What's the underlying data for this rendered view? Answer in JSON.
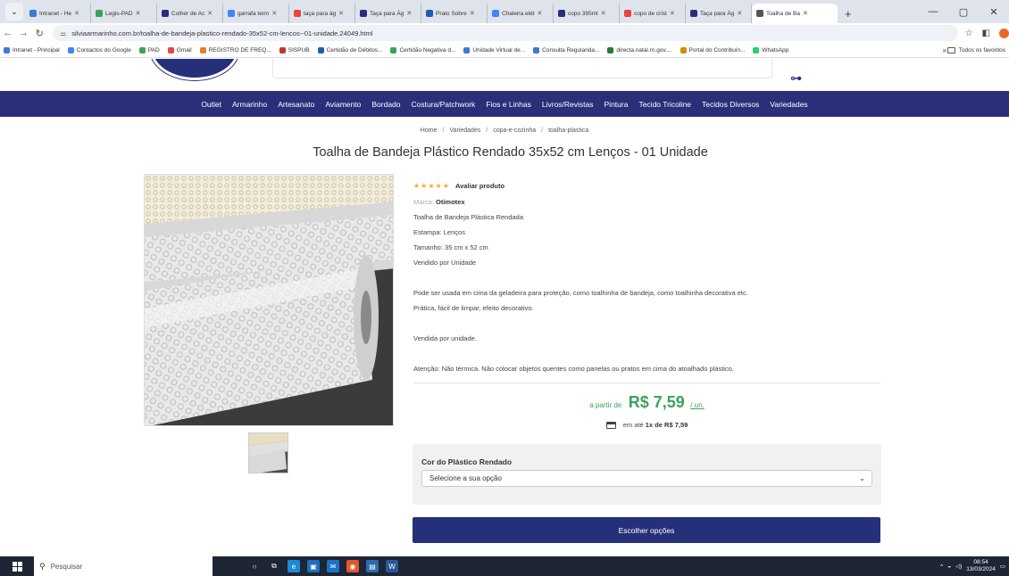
{
  "browser": {
    "tabs": [
      {
        "title": "Intranet - He",
        "color": "#3a7bd5",
        "active": false
      },
      {
        "title": "Legis-PAD",
        "color": "#3ba35a",
        "active": false
      },
      {
        "title": "Colher de Ac",
        "color": "#26307a",
        "active": false
      },
      {
        "title": "garrafa term",
        "color": "#4285f4",
        "active": false
      },
      {
        "title": "taça para ág",
        "color": "#e8453c",
        "active": false
      },
      {
        "title": "Taça para Ág",
        "color": "#26307a",
        "active": false
      },
      {
        "title": "Prato Sobre",
        "color": "#1f5fa8",
        "active": false
      },
      {
        "title": "Chaleira elét",
        "color": "#4285f4",
        "active": false
      },
      {
        "title": "copo 395ml",
        "color": "#26307a",
        "active": false
      },
      {
        "title": "copo de crist",
        "color": "#e8453c",
        "active": false
      },
      {
        "title": "Taça para Ág",
        "color": "#26307a",
        "active": false
      },
      {
        "title": "Toalha de Ba",
        "color": "#555555",
        "active": true
      }
    ],
    "new_tab": "+",
    "window_controls": {
      "minimize": "—",
      "maximize": "▢",
      "close": "✕"
    },
    "url": "silviaarmarinho.com.br/toalha-de-bandeja-plastico-rendado-35x52-cm-lencos--01-unidade.24049.html",
    "bookmarks": [
      {
        "label": "Intranet - Principal",
        "color": "#3a7bd5"
      },
      {
        "label": "Contactos do Google",
        "color": "#4285f4"
      },
      {
        "label": "PAD",
        "color": "#3ba35a"
      },
      {
        "label": "Gmail",
        "color": "#e8453c"
      },
      {
        "label": "REGISTRO DE FREQ...",
        "color": "#e67e22"
      },
      {
        "label": "SISPUB",
        "color": "#c0392b"
      },
      {
        "label": "Certidão de Débitos...",
        "color": "#1f5fa8"
      },
      {
        "label": "Certidão Negativa d...",
        "color": "#3ba35a"
      },
      {
        "label": "Unidade Virtual de...",
        "color": "#3a7bd5"
      },
      {
        "label": "Consulta Regularida...",
        "color": "#3a7bd5"
      },
      {
        "label": "directa.natal.rn.gov....",
        "color": "#2d7a2d"
      },
      {
        "label": "Portal do Contribuin...",
        "color": "#d68910"
      },
      {
        "label": "WhatsApp",
        "color": "#25d366"
      }
    ],
    "bookmarks_more": "»",
    "all_favorites": "Todos os favoritos"
  },
  "site": {
    "nav": [
      "Outlet",
      "Armarinho",
      "Artesanato",
      "Aviamento",
      "Bordado",
      "Costura/Patchwork",
      "Fios e Linhas",
      "Livros/Revistas",
      "Pintura",
      "Tecido Tricoline",
      "Tecidos Diversos",
      "Variedades"
    ]
  },
  "breadcrumb": [
    "Home",
    "Variedades",
    "copa-e-cozinha",
    "toalha-plastica"
  ],
  "product": {
    "title": "Toalha de Bandeja Plástico Rendado 35x52 cm Lenços - 01 Unidade",
    "rating_stars": 5,
    "rate_label": "Avaliar produto",
    "brand_label": "Marca:",
    "brand": "Otimotex",
    "desc_lines": [
      "Toalha de Bandeja Plástica Rendada",
      "Estampa: Lenços",
      "Tamanho: 35 cm x 52 cm",
      "Vendido por Unidade"
    ],
    "para1": "Pode ser usada em cima da geladeira para proteção, como toalhinha de bandeja, como toalhinha decorativa etc.",
    "para2": "Prática, fácil de limpar, efeito decorativo.",
    "para3": "Vendida por unidade.",
    "para4": "Atenção: Não térmica. Não colocar objetos quentes como panelas ou pratos em cima do atoalhado plástico.",
    "price_prefix": "a partir de",
    "price": "R$ 7,59",
    "price_unit": "/ un.",
    "installment_prefix": "em até",
    "installment": "1x de R$ 7,59",
    "option_label": "Cor do Plástico Rendado",
    "option_placeholder": "Selecione a sua opção",
    "choose_button": "Escolher opções"
  },
  "taskbar": {
    "search_placeholder": "Pesquisar",
    "time": "08:54",
    "date": "13/03/2024"
  }
}
